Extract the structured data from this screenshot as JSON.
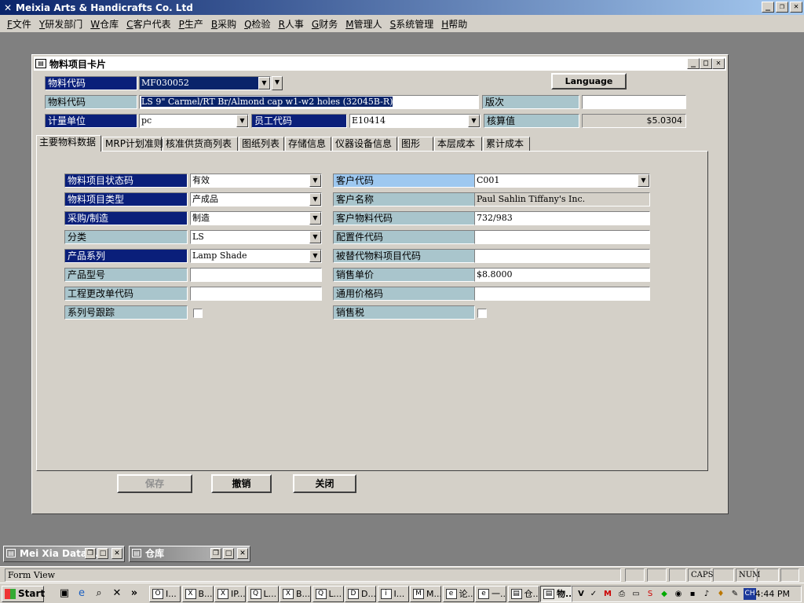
{
  "app": {
    "title": "Meixia Arts & Handicrafts Co. Ltd",
    "window_buttons": [
      "_",
      "❐",
      "✕"
    ]
  },
  "menu": [
    {
      "key": "F",
      "label": "文件"
    },
    {
      "key": "Y",
      "label": "研发部门"
    },
    {
      "key": "W",
      "label": "仓库"
    },
    {
      "key": "C",
      "label": "客户代表"
    },
    {
      "key": "P",
      "label": "生产"
    },
    {
      "key": "B",
      "label": "采购"
    },
    {
      "key": "Q",
      "label": "检验"
    },
    {
      "key": "R",
      "label": "人事"
    },
    {
      "key": "G",
      "label": "财务"
    },
    {
      "key": "M",
      "label": "管理人"
    },
    {
      "key": "S",
      "label": "系统管理"
    },
    {
      "key": "H",
      "label": "帮助"
    }
  ],
  "form": {
    "title": "物料项目卡片",
    "language_button": "Language",
    "header": {
      "item_code_label": "物料代码",
      "item_code_value": "MF030052",
      "description_label": "物料代码",
      "description_value": "LS  9\" Carmel/RT Br/Almond cap w1-w2 holes (32045B-R)",
      "revision_label": "版次",
      "revision_value": "",
      "uom_label": "计量单位",
      "uom_value": "pc",
      "employee_label": "员工代码",
      "employee_value": "E10414",
      "cost_label": "核算值",
      "cost_value": "$5.0304"
    },
    "tabs": [
      {
        "label": "主要物料数据",
        "active": true
      },
      {
        "label": "MRP计划准则"
      },
      {
        "label": "核准供货商列表"
      },
      {
        "label": "图纸列表"
      },
      {
        "label": "存储信息"
      },
      {
        "label": "仪器设备信息"
      },
      {
        "label": "图形"
      },
      {
        "label": "本层成本"
      },
      {
        "label": "累计成本"
      }
    ],
    "left_fields": [
      {
        "label": "物料项目状态码",
        "value": "有效",
        "style": "dark",
        "dropdown": true
      },
      {
        "label": "物料项目类型",
        "value": "产成品",
        "style": "dark",
        "dropdown": true
      },
      {
        "label": "采购/制造",
        "value": "制造",
        "style": "dark",
        "dropdown": true
      },
      {
        "label": "分类",
        "value": "LS",
        "style": "light",
        "dropdown": true
      },
      {
        "label": "产品系列",
        "value": "Lamp Shade",
        "style": "dark",
        "dropdown": true
      },
      {
        "label": "产品型号",
        "value": "",
        "style": "light",
        "dropdown": false
      },
      {
        "label": "工程更改单代码",
        "value": "",
        "style": "light",
        "dropdown": false
      },
      {
        "label": "系列号跟踪",
        "value": "",
        "style": "light",
        "checkbox": true
      }
    ],
    "right_fields": [
      {
        "label": "客户代码",
        "value": "C001",
        "style": "sky",
        "dropdown": true
      },
      {
        "label": "客户名称",
        "value": "Paul Sahlin Tiffany's Inc.",
        "style": "light",
        "readonly": true
      },
      {
        "label": "客户物料代码",
        "value": "732/983",
        "style": "light"
      },
      {
        "label": "配置件代码",
        "value": "",
        "style": "light"
      },
      {
        "label": "被替代物料项目代码",
        "value": "",
        "style": "light"
      },
      {
        "label": "销售单价",
        "value": "$8.8000",
        "style": "light"
      },
      {
        "label": "通用价格码",
        "value": "",
        "style": "light"
      },
      {
        "label": "销售税",
        "value": "",
        "style": "light",
        "checkbox": true
      }
    ],
    "buttons": {
      "save": "保存",
      "undo": "撤销",
      "close": "关闭"
    }
  },
  "minimized": [
    {
      "title": "Mei Xia Data..."
    },
    {
      "title": "仓库"
    }
  ],
  "status": {
    "text": "Form View",
    "caps": "CAPS",
    "num": "NUM"
  },
  "taskbar": {
    "start": "Start",
    "tasks": [
      {
        "icon": "O",
        "label": "I..."
      },
      {
        "icon": "X",
        "label": "B..."
      },
      {
        "icon": "X",
        "label": "IP..."
      },
      {
        "icon": "Q",
        "label": "L..."
      },
      {
        "icon": "X",
        "label": "B..."
      },
      {
        "icon": "Q",
        "label": "L..."
      },
      {
        "icon": "D",
        "label": "D..."
      },
      {
        "icon": "i",
        "label": "I..."
      },
      {
        "icon": "M",
        "label": "M..."
      },
      {
        "icon": "e",
        "label": "论..."
      },
      {
        "icon": "e",
        "label": "一..."
      },
      {
        "icon": "▤",
        "label": "仓..."
      },
      {
        "icon": "▤",
        "label": "物..."
      }
    ],
    "tray_lang": "CH",
    "clock": "4:44 PM"
  }
}
